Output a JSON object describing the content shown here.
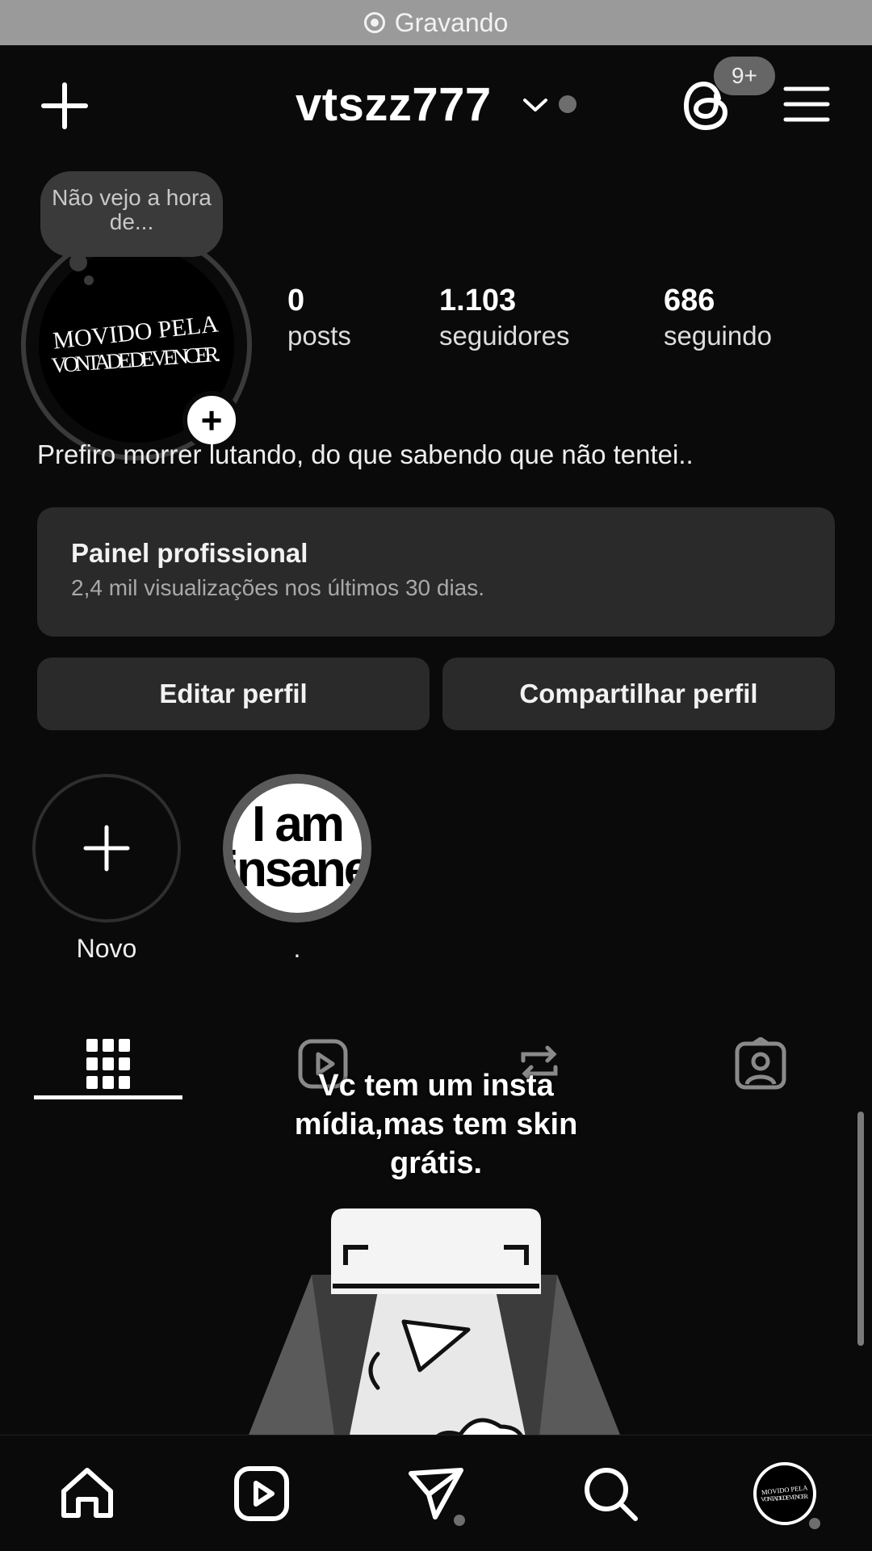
{
  "status_bar": {
    "recording_label": "Gravando"
  },
  "header": {
    "username": "vtszz777",
    "notifications_badge": "9+"
  },
  "profile": {
    "note_text": "Não vejo a hora de...",
    "avatar_text_line1": "MOVIDO PELA",
    "avatar_text_line2": "VONTADE DE VENCER.",
    "stats": {
      "posts_count": "0",
      "posts_label": "posts",
      "followers_count": "1.103",
      "followers_label": "seguidores",
      "following_count": "686",
      "following_label": "seguindo"
    },
    "bio": "Prefiro morrer lutando, do que sabendo que não tentei.."
  },
  "professional_panel": {
    "title": "Painel profissional",
    "subtitle": "2,4 mil visualizações nos últimos 30 dias."
  },
  "actions": {
    "edit_label": "Editar perfil",
    "share_label": "Compartilhar perfil"
  },
  "highlights": [
    {
      "label": "Novo"
    },
    {
      "label": ".",
      "cover_line1": "I am",
      "cover_line2": "insane"
    }
  ],
  "overlay_caption": "Vc tem um insta mídia,mas tem skin grátis.",
  "tabs": {
    "active": "grid",
    "items": [
      "grid-icon",
      "reels-icon",
      "repost-icon",
      "tagged-icon"
    ]
  },
  "bottom_nav": {
    "items": [
      "home-icon",
      "reels-icon",
      "direct-icon",
      "search-icon",
      "profile-avatar"
    ]
  },
  "colors": {
    "background": "#0a0a0a",
    "card": "#2a2a2a",
    "recording_bar": "#9a9a9a"
  }
}
